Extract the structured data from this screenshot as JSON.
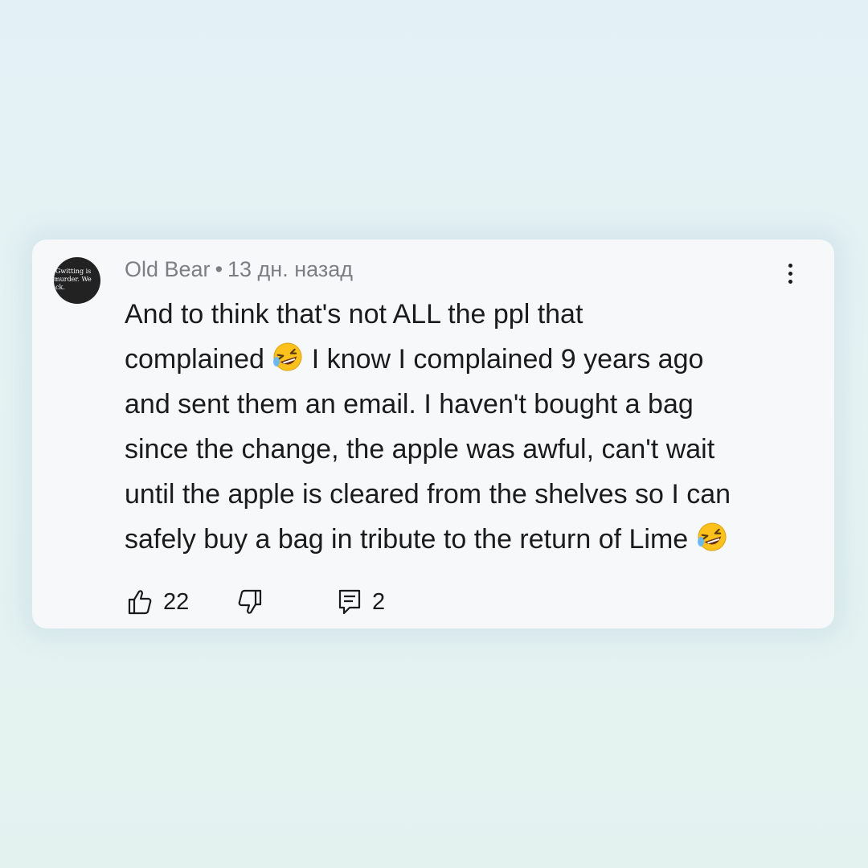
{
  "comment": {
    "author": "Old Bear",
    "separator": "•",
    "timestamp": "13 дн. назад",
    "avatar_text": [
      "Gwitting is",
      "murder. We",
      "ck."
    ],
    "lines": [
      {
        "text": "And to think that's not ALL the ppl that",
        "emoji_after": ""
      },
      {
        "text": "complained ",
        "emoji_after": "rolling-on-floor-laughing",
        "text_after": " I know I complained 9 years ago"
      },
      {
        "text": "and sent them an email. I haven't bought a bag",
        "emoji_after": ""
      },
      {
        "text": "since the change, the apple was awful, can't wait",
        "emoji_after": ""
      },
      {
        "text": "until the apple is cleared from the shelves so I can",
        "emoji_after": ""
      },
      {
        "text": "safely buy a bag in tribute to the return of Lime ",
        "emoji_after": "rolling-on-floor-laughing"
      }
    ]
  },
  "actions": {
    "like_count": "22",
    "reply_count": "2",
    "like_icon": "thumbs-up-icon",
    "dislike_icon": "thumbs-down-icon",
    "reply_icon": "reply-comment-icon",
    "menu_icon": "more-vertical-icon"
  },
  "colors": {
    "background": "#e4f2f4",
    "card": "#f6f8f9",
    "meta_text": "#7c7f82",
    "body_text": "#1b1b1b"
  }
}
